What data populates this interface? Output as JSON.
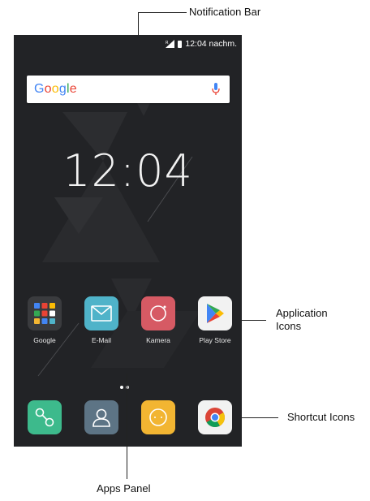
{
  "annotations": {
    "notification_bar": "Notification Bar",
    "application_icons_line1": "Application",
    "application_icons_line2": "Icons",
    "shortcut_icons": "Shortcut Icons",
    "apps_panel": "Apps Panel"
  },
  "status_bar": {
    "time": "12:04 nachm."
  },
  "search": {
    "logo_G": "G",
    "logo_o1": "o",
    "logo_o2": "o",
    "logo_g": "g",
    "logo_l": "l",
    "logo_e": "e",
    "icon": "mic-icon"
  },
  "clock": {
    "time": "12:04"
  },
  "apps": [
    {
      "label": "Google",
      "icon": "folder-icon"
    },
    {
      "label": "E-Mail",
      "icon": "envelope-icon",
      "color": "#4fb3c9"
    },
    {
      "label": "Kamera",
      "icon": "camera-icon",
      "color": "#d65a64"
    },
    {
      "label": "Play Store",
      "icon": "play-store-icon",
      "color": "#f2f2f2"
    }
  ],
  "dock": [
    {
      "icon": "phone-icon",
      "color": "#3dba8c"
    },
    {
      "icon": "contacts-icon",
      "color": "#5d7485"
    },
    {
      "icon": "messages-icon",
      "color": "#f2b532"
    },
    {
      "icon": "chrome-icon",
      "color": "#f2f2f2"
    }
  ]
}
